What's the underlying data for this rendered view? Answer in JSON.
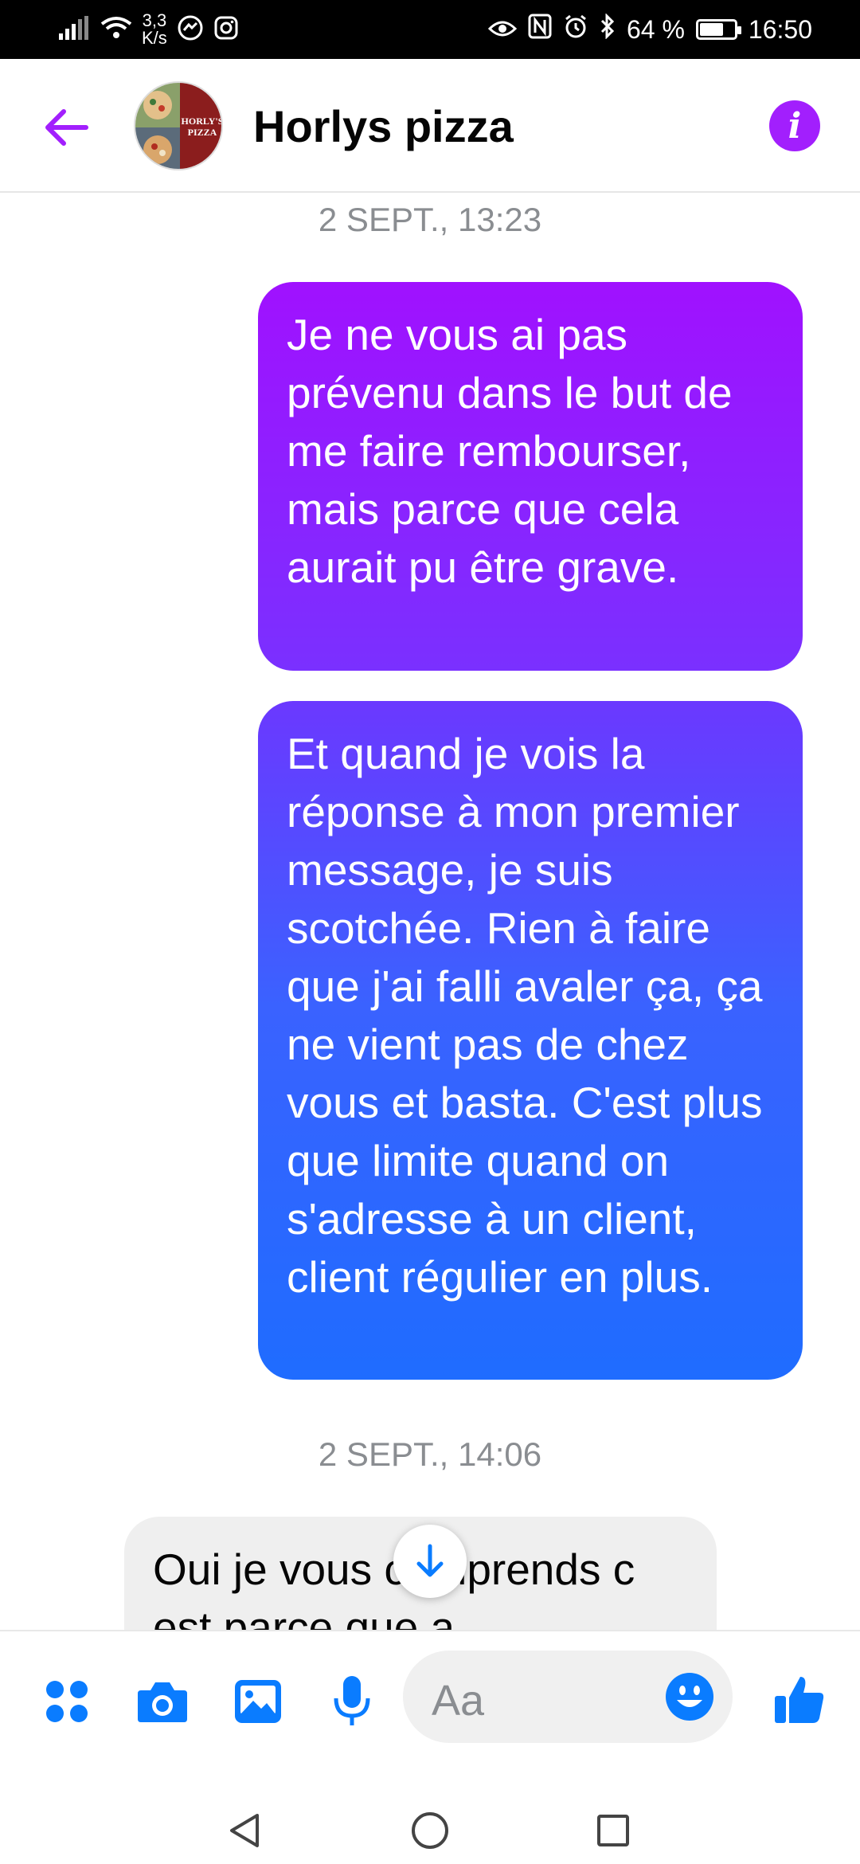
{
  "status_bar": {
    "speed": "3,3",
    "speed_unit": "K/s",
    "battery": "64 %",
    "battery_level": 0.64,
    "time": "16:50"
  },
  "header": {
    "contact_name": "Horlys pizza",
    "avatar_text_line1": "HORLY'S",
    "avatar_text_line2": "PIZZA"
  },
  "messages": [
    {
      "type": "timestamp",
      "text": "2 SEPT., 13:23"
    },
    {
      "type": "outgoing",
      "text": "Je ne vous ai pas prévenu dans le but de me faire rembourser, mais parce que cela aurait pu être grave."
    },
    {
      "type": "outgoing",
      "text": "Et quand je vois la réponse à mon premier message, je suis scotchée. Rien à faire que j'ai falli avaler ça, ça ne vient pas de chez vous et basta. C'est plus que limite quand on s'adresse à un client, client régulier en plus."
    },
    {
      "type": "timestamp",
      "text": "2 SEPT., 14:06"
    },
    {
      "type": "incoming",
      "text": "Oui je vous comprends c est parce que a"
    }
  ],
  "composer": {
    "placeholder": "Aa",
    "icons": [
      "apps-icon",
      "camera-icon",
      "gallery-icon",
      "microphone-icon",
      "emoji-icon",
      "thumbs-up-icon"
    ]
  },
  "colors": {
    "accent": "#a21ffd",
    "composer_blue": "#0a7cff",
    "outgoing_top": "#a011ff",
    "outgoing_bottom": "#1f6cff",
    "incoming_bg": "#efefef"
  }
}
